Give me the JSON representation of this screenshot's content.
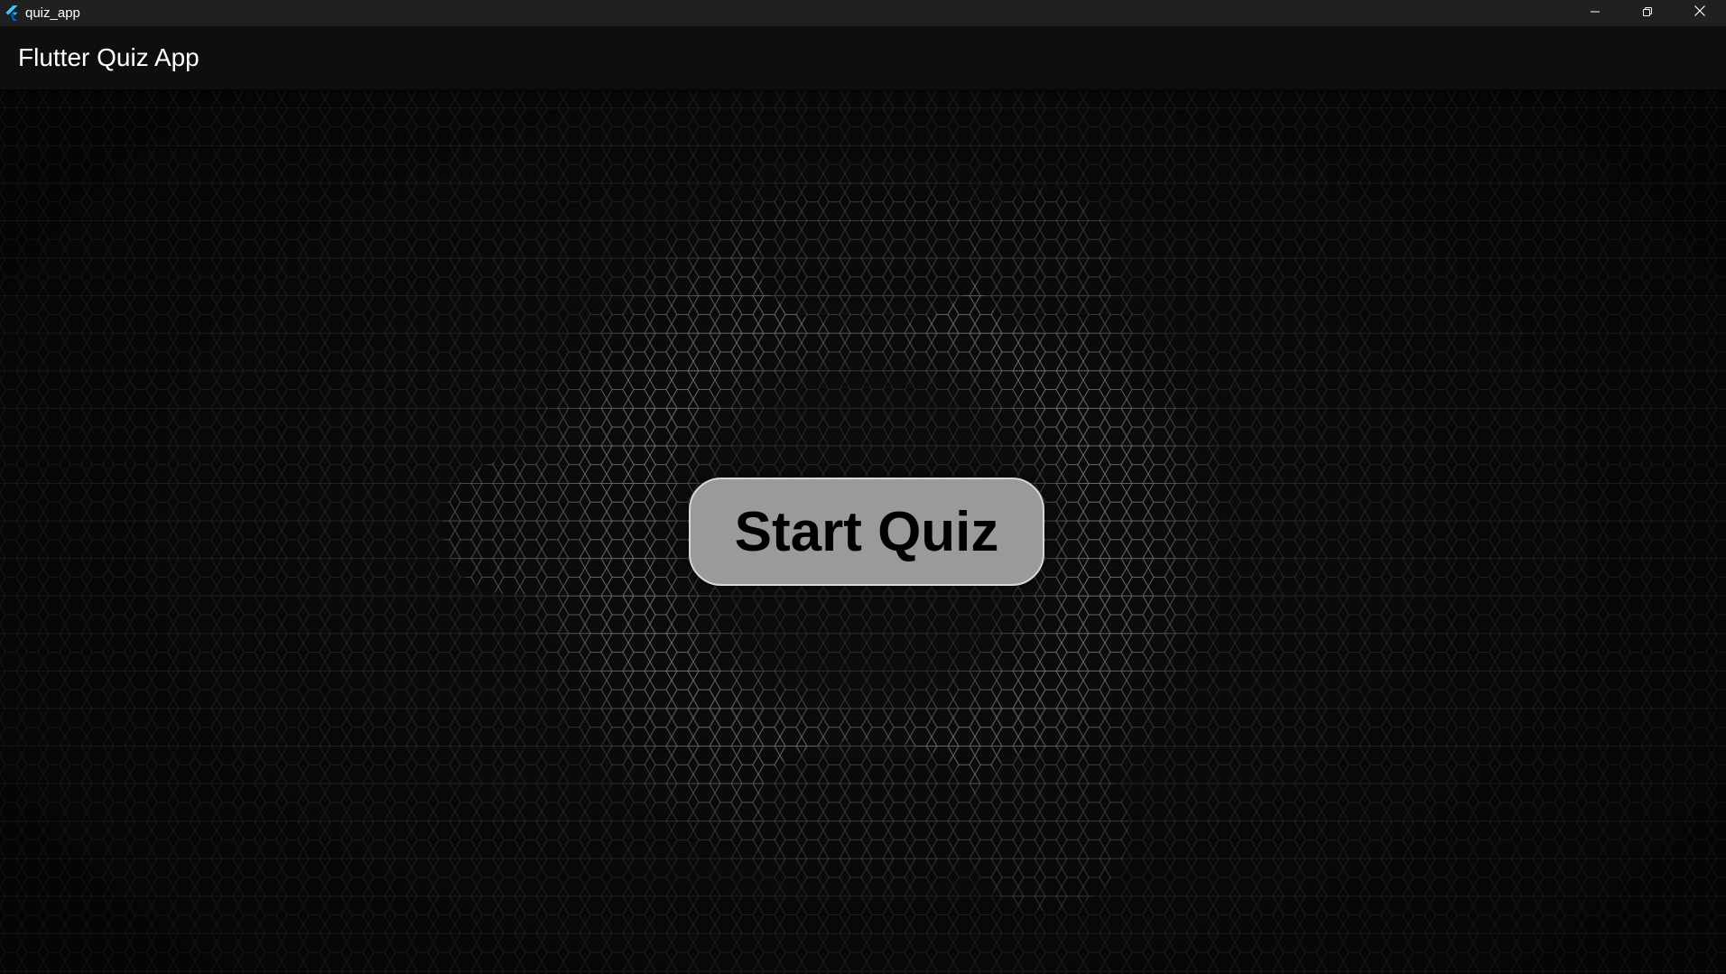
{
  "window": {
    "title": "quiz_app",
    "icon": "flutter-logo-icon",
    "controls": {
      "minimize_icon": "minimize-icon",
      "restore_icon": "restore-icon",
      "close_icon": "close-icon"
    }
  },
  "appbar": {
    "title": "Flutter Quiz App"
  },
  "main": {
    "start_button_label": "Start Quiz",
    "background_pattern": "hexagon-mesh"
  },
  "colors": {
    "titlebar_bg": "#202020",
    "appbar_bg": "#0e0e0e",
    "content_bg": "#0a0a0a",
    "button_bg": "#999a99",
    "button_text": "#000000",
    "flutter_blue_light": "#47c5fb",
    "flutter_blue_dark": "#0468d7"
  }
}
